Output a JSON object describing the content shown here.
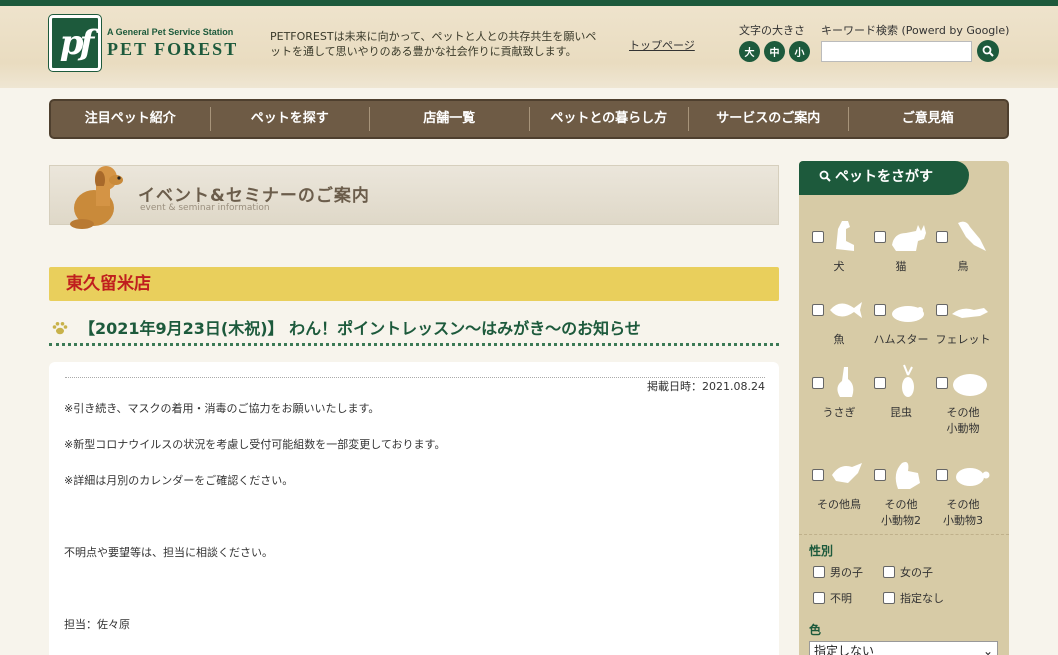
{
  "header": {
    "logo_sub": "A General Pet Service Station",
    "logo_main": "PET FOREST",
    "logo_mark": "pf",
    "tagline": "PETFORESTは未来に向かって、ペットと人との共存共生を願いペットを通して思いやりのある豊かな社会作りに貢献致します。",
    "top_link": "トップページ",
    "font_size_label": "文字の大きさ",
    "font_sizes": [
      "大",
      "中",
      "小"
    ],
    "search_label": "キーワード検索 (Powerd by Google)",
    "search_value": ""
  },
  "gnav": [
    "注目ペット紹介",
    "ペットを探す",
    "店舗一覧",
    "ペットとの暮らし方",
    "サービスのご案内",
    "ご意見箱"
  ],
  "hero": {
    "title": "イベント&セミナーのご案内",
    "subtitle": "event & seminar information"
  },
  "shop": "東久留米店",
  "event_title": "【2021年9月23日(木祝)】 わん！ポイントレッスン～はみがき～のお知らせ",
  "article": {
    "post_date": "掲載日時：2021.08.24",
    "paragraphs": [
      "※引き続き、マスクの着用・消毒のご協力をお願いいたします。",
      "※新型コロナウイルスの状況を考慮し受付可能組数を一部変更しております。",
      "※詳細は月別のカレンダーをご確認ください。",
      "不明点や要望等は、担当に相談ください。",
      "担当：佐々原"
    ]
  },
  "sidebar": {
    "title": "ペットをさがす",
    "pets": [
      {
        "label": "犬",
        "icon": "dog-icon"
      },
      {
        "label": "猫",
        "icon": "cat-icon"
      },
      {
        "label": "鳥",
        "icon": "bird-icon"
      },
      {
        "label": "魚",
        "icon": "fish-icon"
      },
      {
        "label": "ハムスター",
        "icon": "hamster-icon"
      },
      {
        "label": "フェレット",
        "icon": "ferret-icon"
      },
      {
        "label": "うさぎ",
        "icon": "rabbit-icon"
      },
      {
        "label": "昆虫",
        "icon": "beetle-icon"
      },
      {
        "label": "その他\n小動物",
        "icon": "small-animal-icon"
      },
      {
        "label": "その他鳥",
        "icon": "other-bird-icon"
      },
      {
        "label": "その他\n小動物2",
        "icon": "squirrel-icon"
      },
      {
        "label": "その他\n小動物3",
        "icon": "turtle-icon"
      }
    ],
    "gender_label": "性別",
    "genders": [
      "男の子",
      "女の子",
      "不明",
      "指定なし"
    ],
    "color_label": "色",
    "color_selected": "指定しない"
  }
}
